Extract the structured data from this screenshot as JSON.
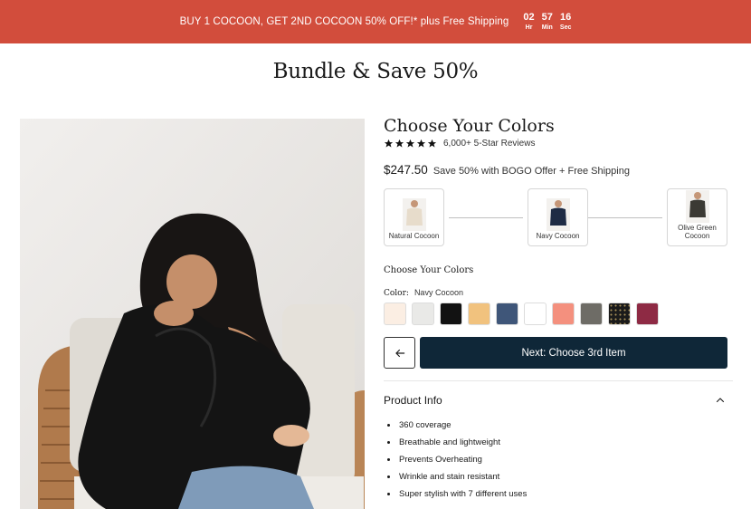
{
  "promo": {
    "text": "BUY 1 COCOON, GET 2ND COCOON 50% OFF!* plus Free Shipping",
    "countdown": [
      {
        "value": "02",
        "unit": "Hr"
      },
      {
        "value": "57",
        "unit": "Min"
      },
      {
        "value": "16",
        "unit": "Sec"
      }
    ]
  },
  "page_title": "Bundle & Save 50%",
  "product": {
    "heading": "Choose Your Colors",
    "rating_stars": 5,
    "reviews": "6,000+ 5-Star Reviews",
    "price": "$247.50",
    "savings": "Save 50% with BOGO Offer + Free Shipping"
  },
  "bundle_slots": [
    {
      "label": "Natural Cocoon",
      "color": "#e7dccb"
    },
    {
      "label": "Navy Cocoon",
      "color": "#1e2b44"
    },
    {
      "label": "Olive Green Cocoon",
      "color": "#3b3a34"
    }
  ],
  "color_picker": {
    "heading": "Choose Your Colors",
    "label": "Color:",
    "selected": "Navy Cocoon",
    "swatches": [
      {
        "name": "Natural",
        "color": "#fbeee3"
      },
      {
        "name": "Light Gray",
        "color": "#e9e9e7"
      },
      {
        "name": "Black",
        "color": "#121212"
      },
      {
        "name": "Camel",
        "color": "#f1c27e"
      },
      {
        "name": "Navy",
        "color": "#3f5679"
      },
      {
        "name": "White",
        "color": "#ffffff"
      },
      {
        "name": "Coral",
        "color": "#f4907e"
      },
      {
        "name": "Olive",
        "color": "#6e6c66"
      },
      {
        "name": "Black Dot",
        "color": "#1b1b1b"
      },
      {
        "name": "Burgundy",
        "color": "#8e2a44"
      }
    ]
  },
  "buttons": {
    "back_icon": "arrow-left-icon",
    "next_label": "Next: Choose 3rd Item"
  },
  "product_info": {
    "heading": "Product Info",
    "toggle_icon": "chevron-up-icon",
    "bullets": [
      "360 coverage",
      "Breathable and lightweight",
      "Prevents Overheating",
      "Wrinkle and stain resistant",
      "Super stylish with 7 different uses"
    ]
  },
  "colors": {
    "promo_bg": "#d24d3c",
    "cta_bg": "#0f2738"
  }
}
